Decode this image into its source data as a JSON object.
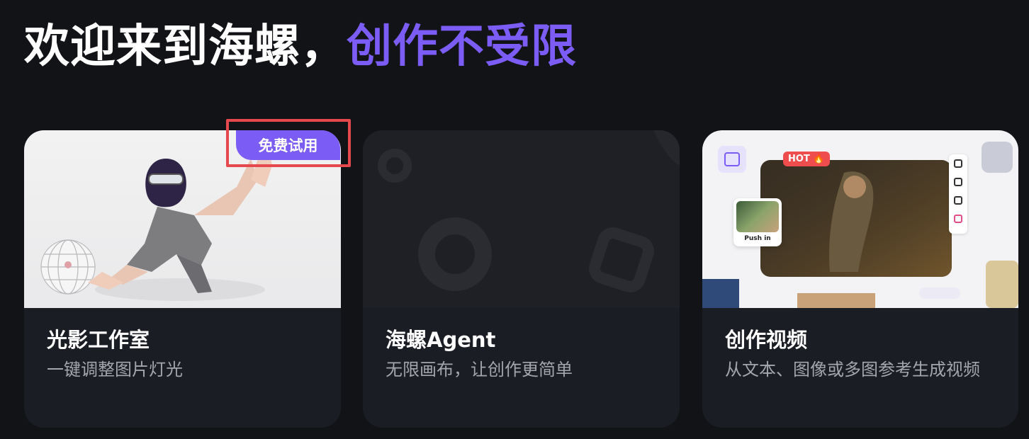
{
  "header": {
    "title_part1": "欢迎来到海螺，",
    "title_part2": "创作不受限"
  },
  "cards": [
    {
      "title": "光影工作室",
      "description": "一键调整图片灯光",
      "badge": "免费试用"
    },
    {
      "title": "海螺Agent",
      "description": "无限画布，让创作更简单"
    },
    {
      "title": "创作视频",
      "description": "从文本、图像或多图参考生成视频",
      "hot_label": "HOT",
      "preview_chip": "Push in"
    }
  ],
  "colors": {
    "background": "#121316",
    "accent": "#7b5cf5",
    "card": "#1b1d24",
    "highlight": "#e5484d"
  }
}
